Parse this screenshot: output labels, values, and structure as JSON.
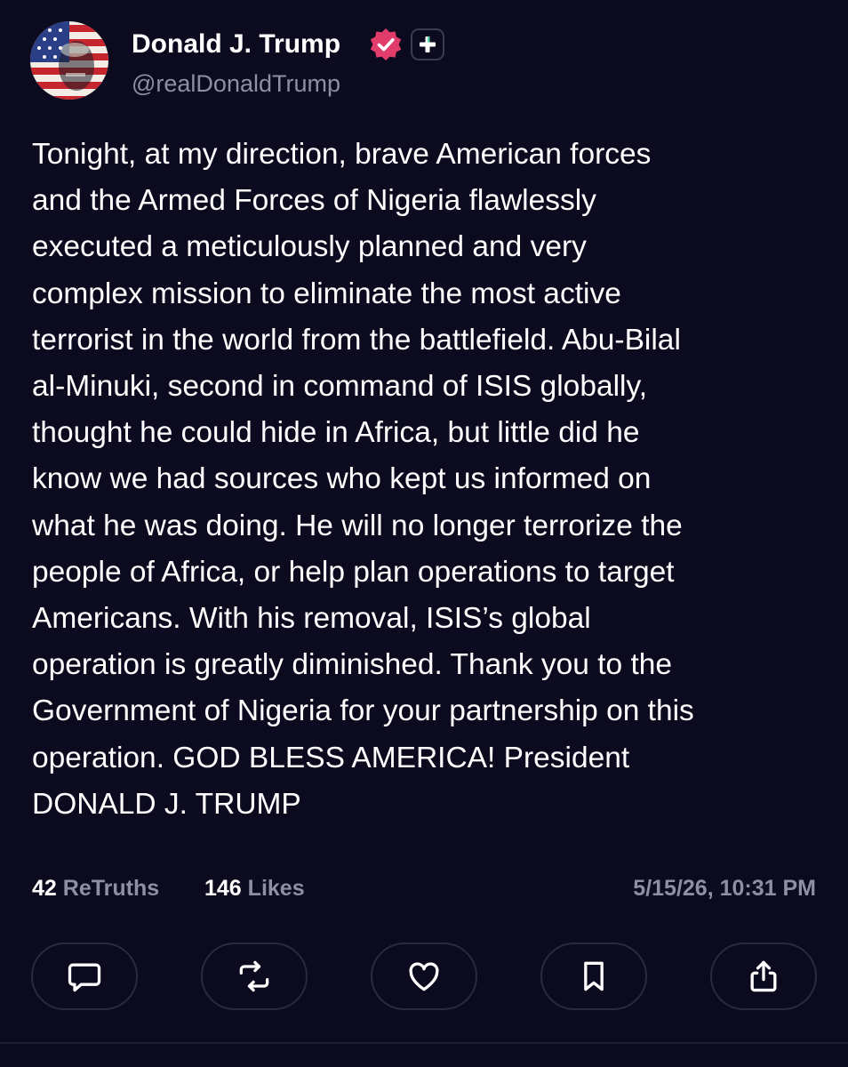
{
  "author": {
    "display_name": "Donald J. Trump",
    "handle": "@realDonaldTrump",
    "avatar_icon": "american-flag-portrait-avatar",
    "verified_icon": "verified-badge-icon",
    "verified_color": "#e23d6a",
    "subscribe_icon": "plus-icon",
    "plus_color": "#55d1a8"
  },
  "post": {
    "text": "Tonight, at my direction, brave American forces\nand the Armed Forces of Nigeria flawlessly\nexecuted a meticulously planned and very\ncomplex mission to eliminate the most active\nterrorist in the world from the battlefield. Abu-Bilal\nal-Minuki, second in command of ISIS globally,\nthought he could hide in Africa, but little did he\nknow we had sources who kept us informed on\nwhat he was doing. He will no longer terrorize the\npeople of Africa, or help plan operations to target\nAmericans. With his removal, ISIS’s global\noperation is greatly diminished. Thank you to the\nGovernment of Nigeria for your partnership on this\noperation. GOD BLESS AMERICA! President\nDONALD J. TRUMP"
  },
  "stats": {
    "retruths_count": "42",
    "retruths_label": "ReTruths",
    "likes_count": "146",
    "likes_label": "Likes",
    "timestamp": "5/15/26, 10:31 PM"
  },
  "actions": [
    {
      "name": "reply",
      "icon": "comment-icon"
    },
    {
      "name": "retruth",
      "icon": "repost-icon"
    },
    {
      "name": "like",
      "icon": "heart-icon"
    },
    {
      "name": "bookmark",
      "icon": "bookmark-icon"
    },
    {
      "name": "share",
      "icon": "share-icon"
    }
  ],
  "colors": {
    "background": "#0b0a1f",
    "text_primary": "#ffffff",
    "text_secondary": "#8f8ea3",
    "button_border": "#2a2940"
  }
}
